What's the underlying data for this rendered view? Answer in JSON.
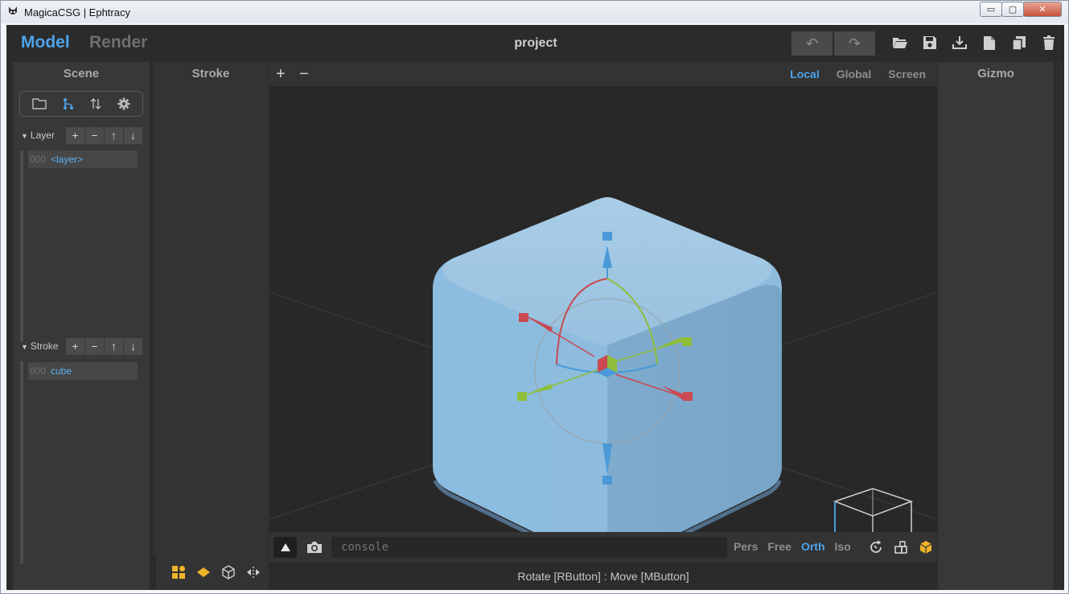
{
  "window": {
    "title": "MagicaCSG | Ephtracy",
    "minimize": "▭",
    "maximize": "▢",
    "close": "✕"
  },
  "top": {
    "mode_model": "Model",
    "mode_render": "Render",
    "project_title": "project",
    "undo": "↶",
    "redo": "↷"
  },
  "scene_panel": {
    "title": "Scene",
    "layer_section": {
      "label": "Layer",
      "buttons": [
        "+",
        "−",
        "↑",
        "↓"
      ],
      "items": [
        {
          "index": "000",
          "name": "<layer>"
        }
      ]
    },
    "stroke_section": {
      "label": "Stroke",
      "buttons": [
        "+",
        "−",
        "↑",
        "↓"
      ],
      "items": [
        {
          "index": "000",
          "name": "cube"
        }
      ]
    }
  },
  "stroke_panel": {
    "title": "Stroke"
  },
  "gizmo_panel": {
    "title": "Gizmo"
  },
  "viewport": {
    "zoom_in": "+",
    "zoom_out": "−",
    "space_modes": [
      "Local",
      "Global",
      "Screen"
    ],
    "active_space": "Local",
    "console_placeholder": "console",
    "projection_modes": [
      "Pers",
      "Free",
      "Orth",
      "Iso"
    ],
    "active_projection": "Orth",
    "status": "Rotate [RButton] : Move [MButton]"
  },
  "colors": {
    "accent": "#4da3ea",
    "shape": "#8ab8d9",
    "x_axis": "#c94a52",
    "y_axis": "#8fbf3a",
    "z_axis": "#4a9ad8",
    "gold": "#f0b429"
  }
}
